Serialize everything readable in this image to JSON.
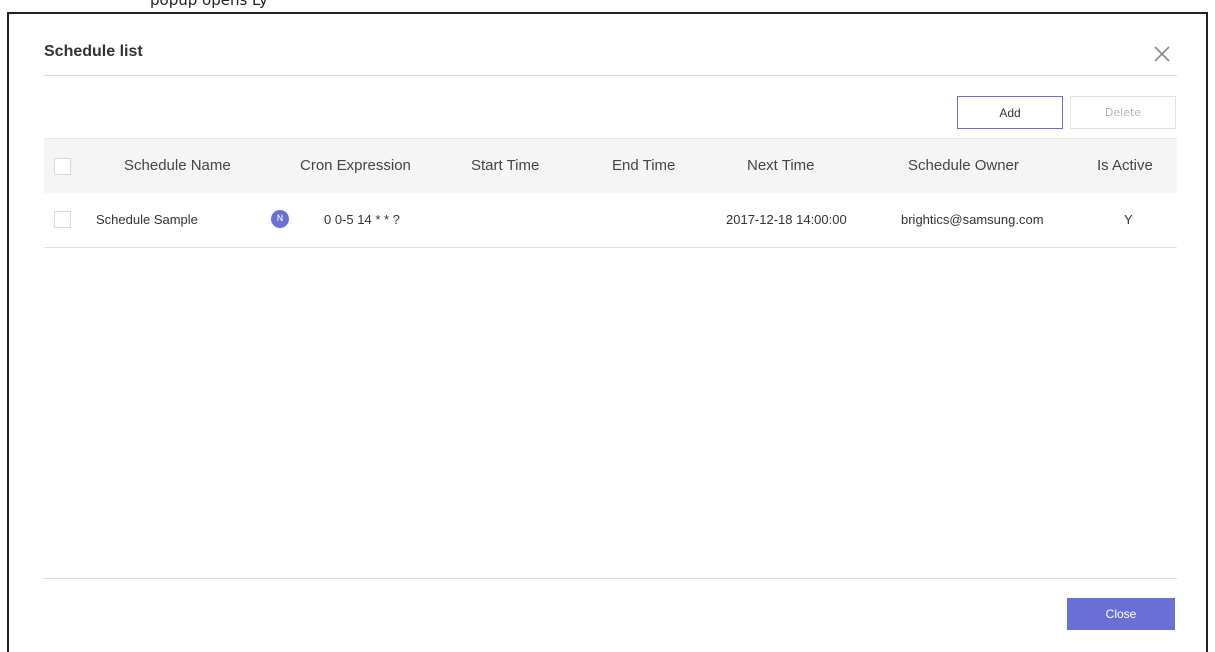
{
  "caption": "popup opens Ly",
  "dialog": {
    "title": "Schedule list",
    "add_label": "Add",
    "delete_label": "Delete",
    "close_label": "Close"
  },
  "table": {
    "columns": [
      "Schedule Name",
      "Cron Expression",
      "Start Time",
      "End Time",
      "Next Time",
      "Schedule Owner",
      "Is Active"
    ],
    "rows": [
      {
        "name": "Schedule Sample",
        "badge": "N",
        "cron": "0 0-5 14 * * ?",
        "start_time": "",
        "end_time": "",
        "next_time": "2017-12-18 14:00:00",
        "owner": "brightics@samsung.com",
        "active": "Y"
      }
    ]
  },
  "colors": {
    "accent": "#6a6fd6",
    "header_bg": "#f5f5f5",
    "border": "#dcdcdc"
  },
  "icons": {
    "close": "close-x-icon",
    "badge": "new-badge-icon"
  }
}
